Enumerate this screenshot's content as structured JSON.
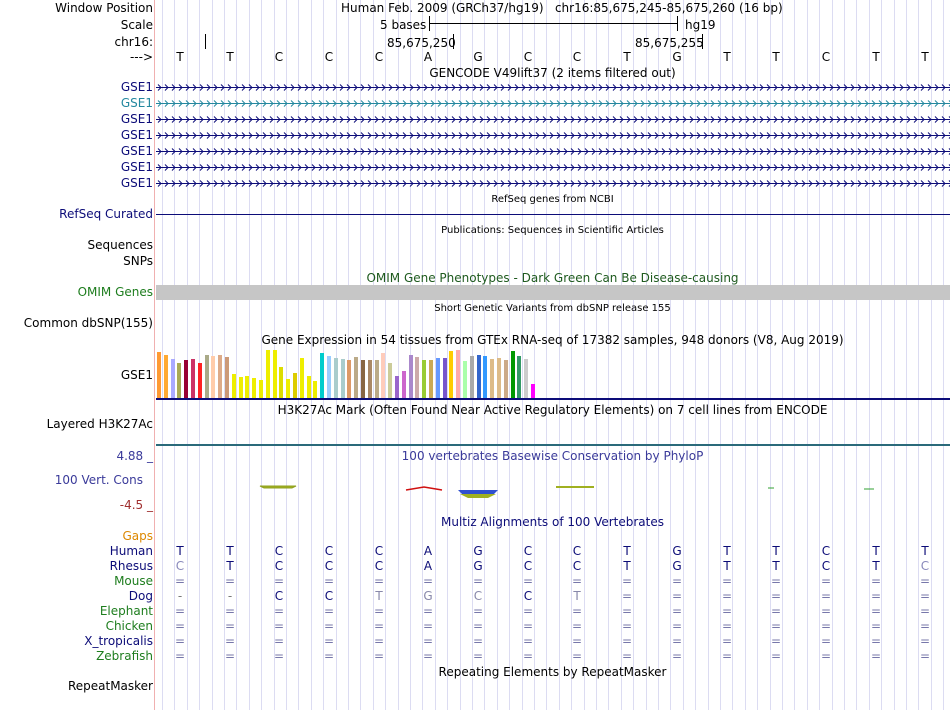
{
  "header": {
    "window_position_label": "Window Position",
    "window_position_text": "Human Feb. 2009 (GRCh37/hg19)   chr16:85,675,245-85,675,260 (16 bp)",
    "scale_label": "Scale",
    "scale_text": "5 bases",
    "assembly_label": "hg19",
    "chrom_label": "chr16:",
    "tick1": "85,675,250",
    "tick2": "85,675,255",
    "arrow_label": "--->",
    "bases": [
      "T",
      "T",
      "C",
      "C",
      "C",
      "A",
      "G",
      "C",
      "C",
      "T",
      "G",
      "T",
      "T",
      "C",
      "T",
      "T"
    ]
  },
  "gencode": {
    "title": "GENCODE V49lift37 (2 items filtered out)",
    "rows": [
      {
        "label": "GSE1",
        "color": "#0c0c78"
      },
      {
        "label": "GSE1",
        "color": "#24889f"
      },
      {
        "label": "GSE1",
        "color": "#0c0c78"
      },
      {
        "label": "GSE1",
        "color": "#0c0c78"
      },
      {
        "label": "GSE1",
        "color": "#0c0c78"
      },
      {
        "label": "GSE1",
        "color": "#0c0c78"
      },
      {
        "label": "GSE1",
        "color": "#0c0c78"
      }
    ]
  },
  "refseq": {
    "title": "RefSeq genes from NCBI",
    "label": "RefSeq Curated"
  },
  "publications": {
    "title": "Publications: Sequences in Scientific Articles",
    "label1": "Sequences",
    "label2": "SNPs"
  },
  "omim": {
    "title": "OMIM Gene Phenotypes - Dark Green Can Be Disease-causing",
    "label": "OMIM Genes"
  },
  "dbsnp": {
    "title": "Short Genetic Variants from dbSNP release 155",
    "label": "Common dbSNP(155)"
  },
  "gtex": {
    "title": "Gene Expression in 54 tissues from GTEx RNA-seq of 17382 samples, 948 donors (V8, Aug 2019)",
    "label": "GSE1",
    "values": [
      44,
      41,
      37,
      34,
      36,
      37,
      34,
      41,
      40,
      41,
      39,
      23,
      20,
      21,
      19,
      17,
      46,
      46,
      30,
      18,
      24,
      38,
      21,
      16,
      43,
      40,
      38,
      37,
      36,
      39,
      36,
      36,
      36,
      43,
      34,
      21,
      26,
      41,
      39,
      36,
      36,
      38,
      38,
      45,
      46,
      35,
      40,
      41,
      40,
      37,
      38,
      36,
      45,
      40,
      37,
      13
    ],
    "colors": [
      "#ff9933",
      "#ffaa33",
      "#aaaaff",
      "#aaaa55",
      "#990033",
      "#cc3366",
      "#ff2222",
      "#aaaa88",
      "#ffccaa",
      "#ddaa88",
      "#cc9977",
      "#eeee00",
      "#eeee00",
      "#eeee00",
      "#eeee00",
      "#eeee00",
      "#eeee00",
      "#eeee00",
      "#dddd00",
      "#eeee00",
      "#ddcc00",
      "#eeee00",
      "#eeee00",
      "#eeee00",
      "#00cccc",
      "#99ccff",
      "#aacccc",
      "#aacccc",
      "#dd9966",
      "#bbaa88",
      "#886644",
      "#aa8866",
      "#bbaa88",
      "#ffccbb",
      "#cccc99",
      "#9966cc",
      "#cc66cc",
      "#aa88cc",
      "#ccaaaa",
      "#99cc33",
      "#ccaa55",
      "#6699ff",
      "#7755cc",
      "#ffcc00",
      "#ffaaaa",
      "#aaffaa",
      "#aaaaaa",
      "#3366cc",
      "#3399ff",
      "#ddbb88",
      "#ddbb88",
      "#ccaa88",
      "#009900",
      "#339966",
      "#cccccc",
      "#ff00ff"
    ]
  },
  "h3k27ac": {
    "title": "H3K27Ac Mark (Often Found Near Active Regulatory Elements) on 7 cell lines from ENCODE",
    "label": "Layered H3K27Ac"
  },
  "conservation": {
    "title": "100 vertebrates Basewise Conservation by PhyloP",
    "label": "100 Vert. Cons",
    "max": "4.88 _",
    "min": "-4.5 _"
  },
  "multiz": {
    "title": "Multiz Alignments of 100 Vertebrates",
    "gaps_label": "Gaps",
    "species": [
      {
        "name": "Human",
        "color": "#0c0c78",
        "bases": [
          "T",
          "T",
          "C",
          "C",
          "C",
          "A",
          "G",
          "C",
          "C",
          "T",
          "G",
          "T",
          "T",
          "C",
          "T",
          "T"
        ],
        "bcolor": "#0c0c78"
      },
      {
        "name": "Rhesus",
        "color": "#0c0c78",
        "bases": [
          "C",
          "T",
          "C",
          "C",
          "C",
          "A",
          "G",
          "C",
          "C",
          "T",
          "G",
          "T",
          "T",
          "C",
          "T",
          "C"
        ],
        "bcolor": "#0c0c78"
      },
      {
        "name": "Mouse",
        "color": "#1e7d1e",
        "bases": [
          "=",
          "=",
          "=",
          "=",
          "=",
          "=",
          "=",
          "=",
          "=",
          "=",
          "=",
          "=",
          "=",
          "=",
          "=",
          "="
        ],
        "bcolor": "#7777aa"
      },
      {
        "name": "Dog",
        "color": "#0c0c78",
        "bases": [
          "-",
          "-",
          "C",
          "C",
          "T",
          "G",
          "C",
          "C",
          "T",
          "=",
          "=",
          "=",
          "=",
          "=",
          "=",
          "="
        ],
        "bcolor": "#0c0c78"
      },
      {
        "name": "Elephant",
        "color": "#1e7d1e",
        "bases": [
          "=",
          "=",
          "=",
          "=",
          "=",
          "=",
          "=",
          "=",
          "=",
          "=",
          "=",
          "=",
          "=",
          "=",
          "=",
          "="
        ],
        "bcolor": "#7777aa"
      },
      {
        "name": "Chicken",
        "color": "#1e7d1e",
        "bases": [
          "=",
          "=",
          "=",
          "=",
          "=",
          "=",
          "=",
          "=",
          "=",
          "=",
          "=",
          "=",
          "=",
          "=",
          "=",
          "="
        ],
        "bcolor": "#7777aa"
      },
      {
        "name": "X_tropicalis",
        "color": "#0c0c78",
        "bases": [
          "=",
          "=",
          "=",
          "=",
          "=",
          "=",
          "=",
          "=",
          "=",
          "=",
          "=",
          "=",
          "=",
          "=",
          "=",
          "="
        ],
        "bcolor": "#7777aa"
      },
      {
        "name": "Zebrafish",
        "color": "#1e7d1e",
        "bases": [
          "=",
          "=",
          "=",
          "=",
          "=",
          "=",
          "=",
          "=",
          "=",
          "=",
          "=",
          "=",
          "=",
          "=",
          "=",
          "="
        ],
        "bcolor": "#7777aa"
      }
    ]
  },
  "repeatmasker": {
    "title": "Repeating Elements by RepeatMasker",
    "label": "RepeatMasker"
  }
}
